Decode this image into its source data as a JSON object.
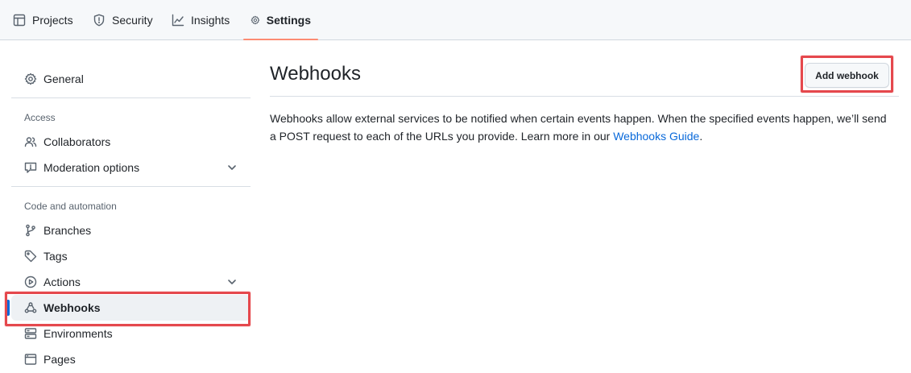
{
  "colors": {
    "accent_blue": "#0969da",
    "active_tab_underline": "#fd8c73",
    "highlight_red": "#e5484d"
  },
  "topnav": {
    "tabs": [
      {
        "label": "Projects",
        "icon": "table-icon",
        "active": false
      },
      {
        "label": "Security",
        "icon": "shield-icon",
        "active": false
      },
      {
        "label": "Insights",
        "icon": "graph-icon",
        "active": false
      },
      {
        "label": "Settings",
        "icon": "gear-icon",
        "active": true
      }
    ]
  },
  "sidebar": {
    "general": "General",
    "section_access": "Access",
    "collaborators": "Collaborators",
    "moderation": "Moderation options",
    "section_code": "Code and automation",
    "branches": "Branches",
    "tags": "Tags",
    "actions": "Actions",
    "webhooks": "Webhooks",
    "environments": "Environments",
    "pages": "Pages"
  },
  "main": {
    "title": "Webhooks",
    "add_button": "Add webhook",
    "description": "Webhooks allow external services to be notified when certain events happen. When the specified events happen, we’ll send a POST request to each of the URLs you provide. Learn more in our ",
    "link_text": "Webhooks Guide",
    "description_end": "."
  }
}
